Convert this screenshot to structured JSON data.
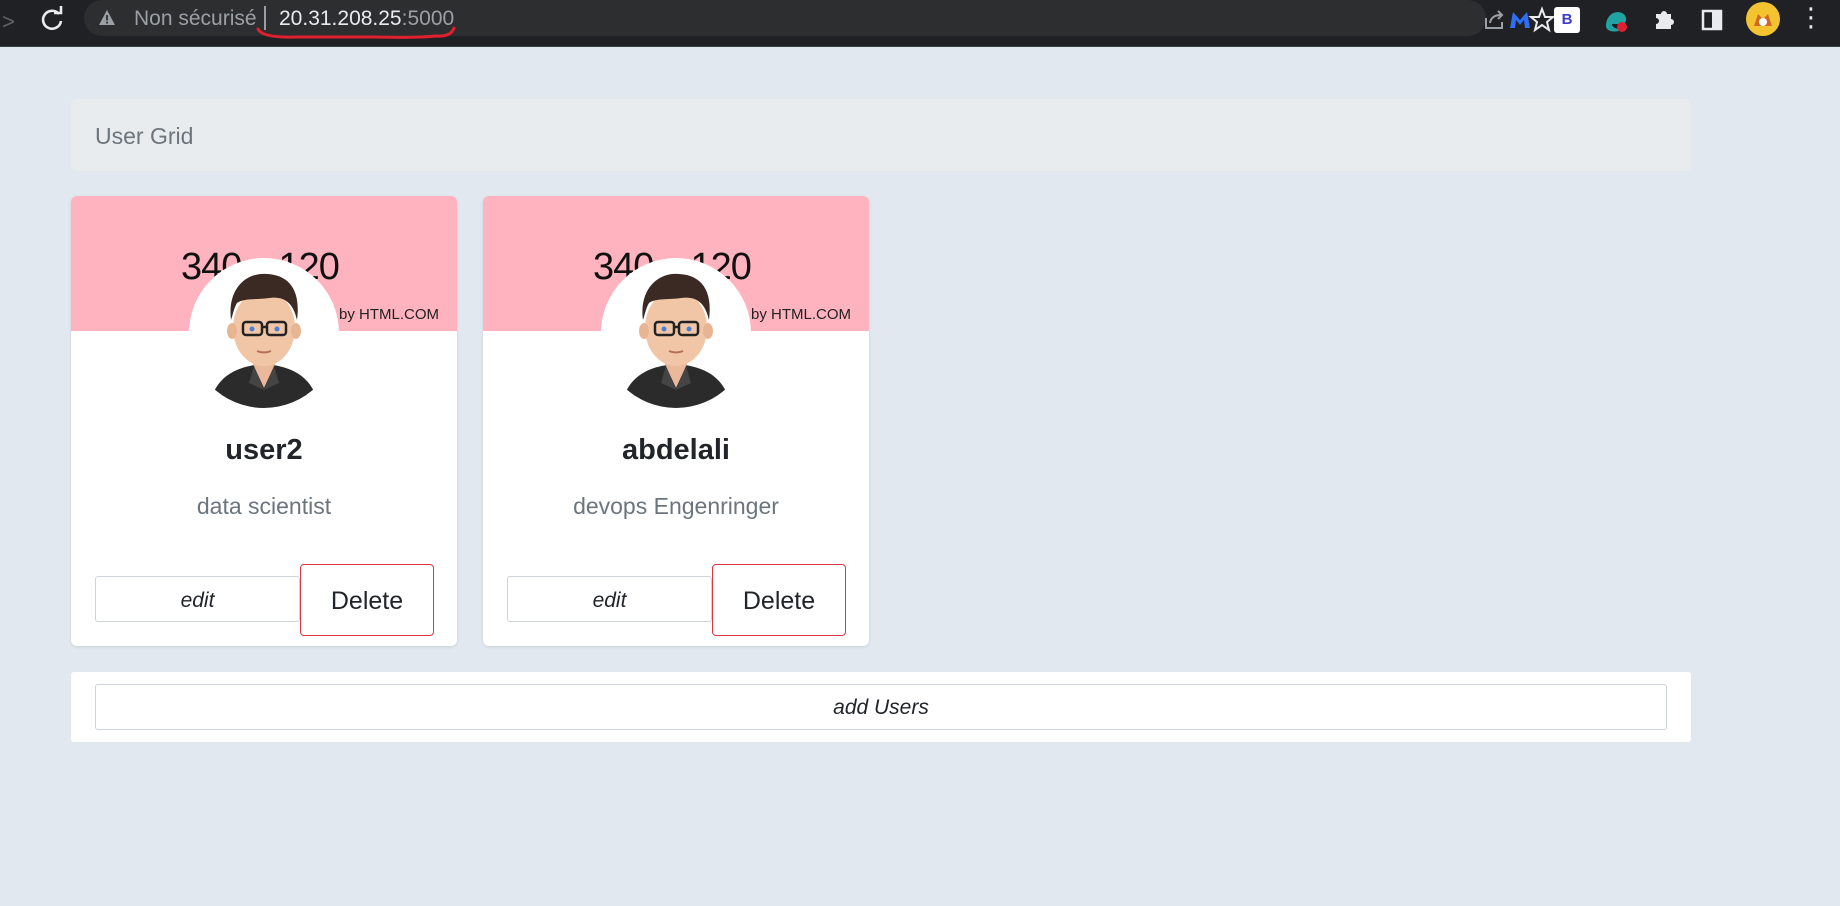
{
  "browser": {
    "security_label": "Non sécurisé",
    "url_host": "20.31.208.25",
    "url_port": ":5000",
    "forward_glyph": ">",
    "menu_glyph": "⋮",
    "ext_b_label": "B",
    "accent_colors": {
      "underline": "#e0202e",
      "malwarebytes": "#2f6ef7",
      "edge_ext": "#1fa3a3"
    }
  },
  "header": {
    "title": "User Grid"
  },
  "banner": {
    "big_text": "340 x 120",
    "small_text": "by HTML.COM",
    "color": "#ffb3be"
  },
  "users": [
    {
      "name": "user2",
      "job": "data scientist",
      "edit_label": "edit",
      "delete_label": "Delete"
    },
    {
      "name": "abdelali",
      "job": "devops Engenringer",
      "edit_label": "edit",
      "delete_label": "Delete"
    }
  ],
  "footer": {
    "add_label": "add Users"
  },
  "colors": {
    "page_bg": "#e2e8f0",
    "delete_border": "#dc3545"
  }
}
